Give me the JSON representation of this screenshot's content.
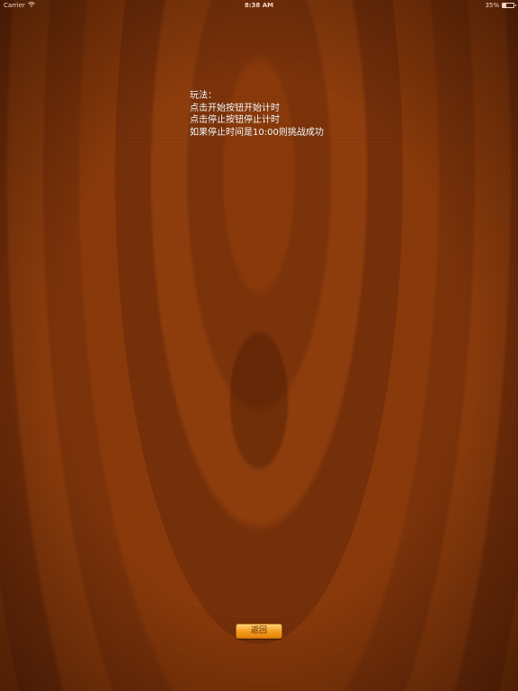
{
  "status_bar": {
    "carrier": "Carrier",
    "time": "8:38 AM",
    "battery": "35%",
    "wifi_icon": "wifi-icon",
    "battery_level": 0.35
  },
  "instructions": {
    "title": "玩法：",
    "line1": "点击开始按钮开始计时",
    "line2": "点击停止按钮停止计时",
    "line3": "如果停止时间是10:00则挑战成功"
  },
  "back_button": {
    "label": "返回"
  },
  "colors": {
    "background": "#7a3208",
    "button": "#f39a1c",
    "text": "#ffffff"
  }
}
